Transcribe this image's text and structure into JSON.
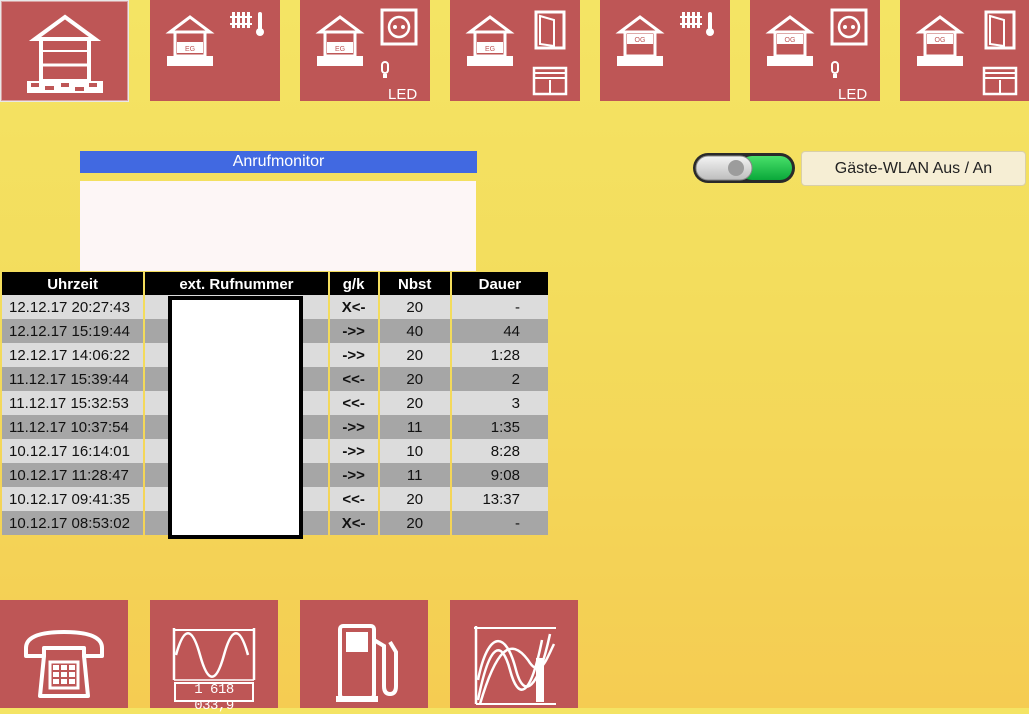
{
  "top_tiles": [
    {
      "name": "house-overview",
      "label": "",
      "active": true
    },
    {
      "name": "eg-heating",
      "label": "EG"
    },
    {
      "name": "eg-power",
      "label": "EG",
      "led": "LED"
    },
    {
      "name": "eg-doors-windows",
      "label": "EG"
    },
    {
      "name": "og-heating",
      "label": "OG"
    },
    {
      "name": "og-power",
      "label": "OG",
      "led": "LED"
    },
    {
      "name": "og-doors-windows",
      "label": "OG"
    }
  ],
  "monitor": {
    "title": "Anrufmonitor"
  },
  "wlan": {
    "button_label": "Gäste-WLAN Aus / An",
    "toggle_on": true
  },
  "table": {
    "headers": [
      "Uhrzeit",
      "ext. Rufnummer",
      "g/k",
      "Nbst",
      "Dauer"
    ],
    "rows": [
      {
        "time": "12.12.17 20:27:43",
        "dir": "X<-",
        "type": "missed",
        "nbst": "20",
        "dur": "-"
      },
      {
        "time": "12.12.17 15:19:44",
        "dir": "->>",
        "type": "out",
        "nbst": "40",
        "dur": "44"
      },
      {
        "time": "12.12.17 14:06:22",
        "dir": "->>",
        "type": "out",
        "nbst": "20",
        "dur": "1:28"
      },
      {
        "time": "11.12.17 15:39:44",
        "dir": "<<-",
        "type": "in",
        "nbst": "20",
        "dur": "2"
      },
      {
        "time": "11.12.17 15:32:53",
        "dir": "<<-",
        "type": "in",
        "nbst": "20",
        "dur": "3"
      },
      {
        "time": "11.12.17 10:37:54",
        "dir": "->>",
        "type": "out",
        "nbst": "11",
        "dur": "1:35"
      },
      {
        "time": "10.12.17 16:14:01",
        "dir": "->>",
        "type": "out",
        "nbst": "10",
        "dur": "8:28"
      },
      {
        "time": "10.12.17 11:28:47",
        "dir": "->>",
        "type": "out",
        "nbst": "11",
        "dur": "9:08"
      },
      {
        "time": "10.12.17 09:41:35",
        "dir": "<<-",
        "type": "in",
        "nbst": "20",
        "dur": "13:37"
      },
      {
        "time": "10.12.17 08:53:02",
        "dir": "X<-",
        "type": "missed",
        "nbst": "20",
        "dur": "-"
      }
    ]
  },
  "bottom_tiles": [
    {
      "name": "telephone"
    },
    {
      "name": "power-meter",
      "counter": "1 618 033,9"
    },
    {
      "name": "fuel"
    },
    {
      "name": "energy-graph"
    }
  ]
}
